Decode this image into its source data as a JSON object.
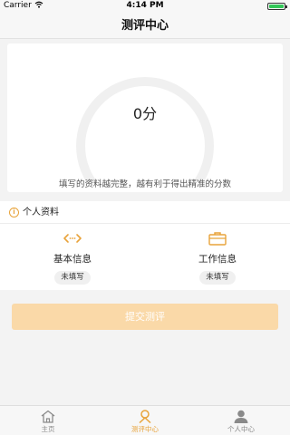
{
  "status_bar": {
    "carrier": "Carrier",
    "time": "4:14 PM",
    "wifi_icon": "wifi-icon",
    "battery_icon": "battery-icon"
  },
  "nav": {
    "title": "测评中心"
  },
  "score": {
    "value_text": "0分",
    "hint": "填写的资料越完整，越有利于得出精准的分数"
  },
  "profile": {
    "section_title": "个人资料",
    "section_icon": "info-icon",
    "items": [
      {
        "label": "基本信息",
        "status": "未填写",
        "icon": "code-arrows-icon"
      },
      {
        "label": "工作信息",
        "status": "未填写",
        "icon": "briefcase-icon"
      }
    ]
  },
  "submit": {
    "label": "提交测评"
  },
  "tabbar": {
    "tabs": [
      {
        "label": "主页",
        "icon": "home-icon"
      },
      {
        "label": "测评中心",
        "icon": "assessment-icon"
      },
      {
        "label": "个人中心",
        "icon": "user-icon"
      }
    ]
  },
  "colors": {
    "accent": "#e8a33a",
    "button_disabled": "#fad9a8",
    "ring": "#f0f0f0",
    "background": "#f3f3f3"
  }
}
